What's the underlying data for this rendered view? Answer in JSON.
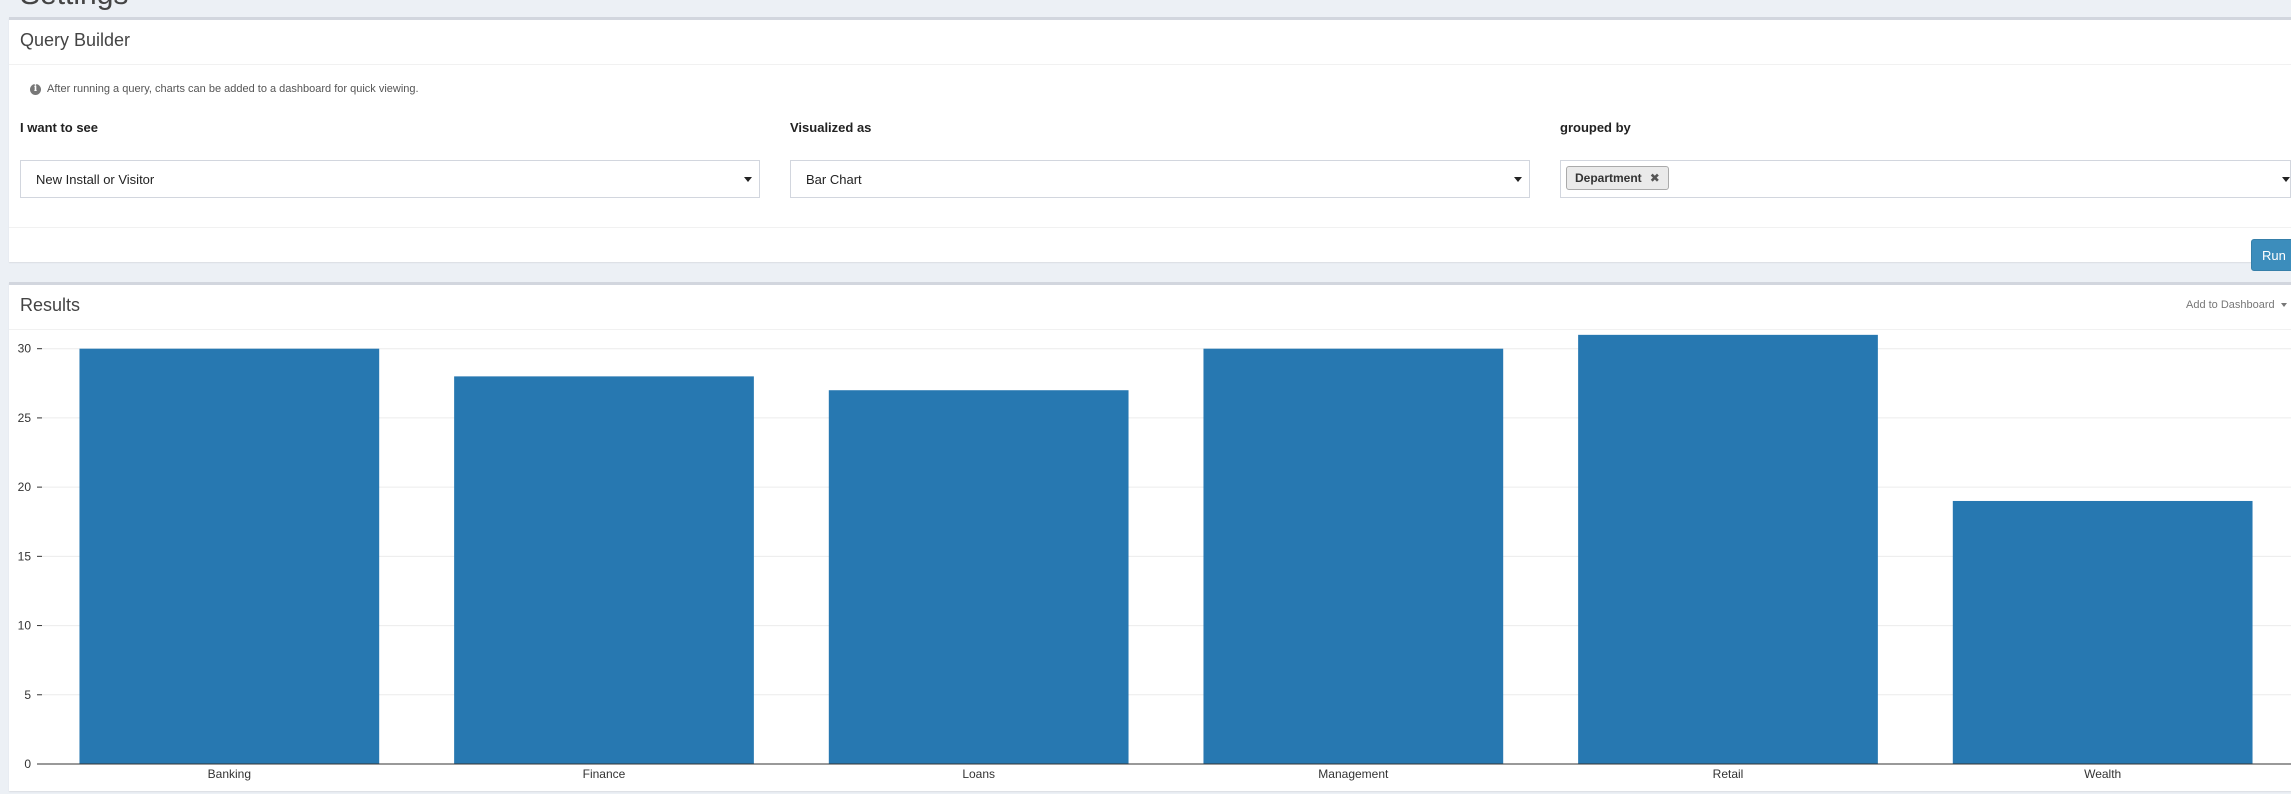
{
  "query_builder": {
    "title": "Query Builder",
    "info_text": "After running a query, charts can be added to a dashboard for quick viewing.",
    "fields": [
      {
        "label": "I want to see",
        "value": "New Install or Visitor"
      },
      {
        "label": "Visualized as",
        "value": "Bar Chart"
      },
      {
        "label": "grouped by",
        "tags": [
          "Department"
        ]
      }
    ],
    "run_label": "Run"
  },
  "results": {
    "title": "Results",
    "add_to_dashboard": "Add to Dashboard"
  },
  "colors": {
    "bar": "#2778b1",
    "run_button": "#3c8dbc"
  },
  "chart_data": {
    "type": "bar",
    "categories": [
      "Banking",
      "Finance",
      "Loans",
      "Management",
      "Retail",
      "Wealth"
    ],
    "values": [
      30,
      28,
      27,
      30,
      31,
      19
    ],
    "ylim": [
      0,
      32
    ],
    "yticks": [
      0,
      5,
      10,
      15,
      20,
      25,
      30
    ],
    "grid": true
  }
}
